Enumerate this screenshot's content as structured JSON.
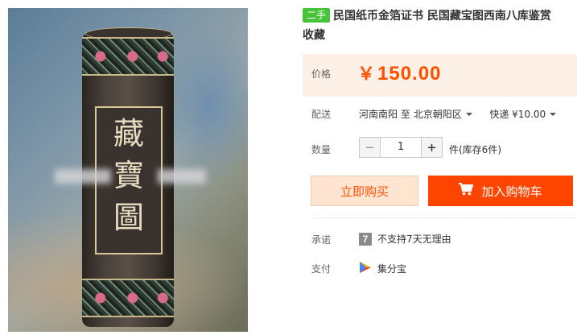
{
  "product": {
    "condition_badge": "二手",
    "title_line1": "民国纸币金箔证书 民国藏宝图西南八库鉴赏",
    "title_line2": "收藏",
    "photo_title": "藏寶圖"
  },
  "price": {
    "label": "价格",
    "symbol": "￥",
    "value": "150.00",
    "color": "#ff5000"
  },
  "shipping": {
    "label": "配送",
    "from": "河南南阳",
    "to_word": "至",
    "destination": "北京朝阳区",
    "method": "快递 ¥10.00"
  },
  "quantity": {
    "label": "数量",
    "minus": "−",
    "value": "1",
    "plus": "+",
    "stock": "件(库存6件)"
  },
  "actions": {
    "buy_now": "立即购买",
    "add_to_cart": "加入购物车",
    "cart_icon": "cart-icon"
  },
  "promise": {
    "label": "承诺",
    "icon_glyph": "7",
    "text": "不支持7天无理由"
  },
  "payment": {
    "label": "支付",
    "method": "集分宝",
    "icon": "jifenbao-icon"
  }
}
